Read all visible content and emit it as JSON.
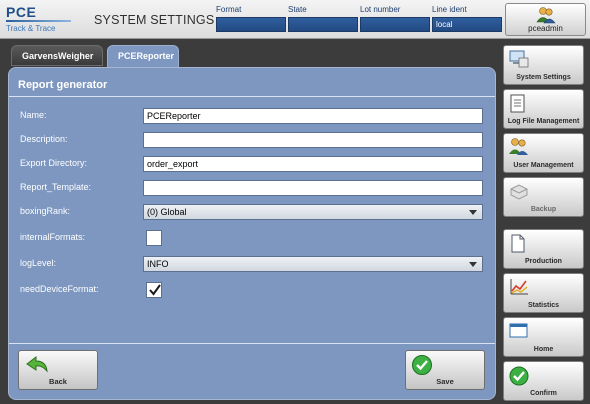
{
  "header": {
    "logo_main": "PCE",
    "logo_sub": "Track & Trace",
    "title": "SYSTEM SETTINGS",
    "fields": [
      {
        "label": "Format",
        "value": ""
      },
      {
        "label": "State",
        "value": ""
      },
      {
        "label": "Lot number",
        "value": ""
      },
      {
        "label": "Line ident",
        "value": "local"
      }
    ],
    "user_name": "pceadmin"
  },
  "tabs": [
    {
      "label": "GarvensWeigher",
      "active": false
    },
    {
      "label": "PCEReporter",
      "active": true
    }
  ],
  "form": {
    "section_title": "Report generator",
    "name": {
      "label": "Name:",
      "value": "PCEReporter"
    },
    "description": {
      "label": "Description:",
      "value": ""
    },
    "export_directory": {
      "label": "Export Directory:",
      "value": "order_export"
    },
    "report_template": {
      "label": "Report_Template:",
      "value": ""
    },
    "boxing_rank": {
      "label": "boxingRank:",
      "value": "(0) Global"
    },
    "internal_formats": {
      "label": "internalFormats:",
      "checked": false
    },
    "log_level": {
      "label": "logLevel:",
      "value": "INFO"
    },
    "need_device_format": {
      "label": "needDeviceFormat:",
      "checked": true
    }
  },
  "buttons": {
    "back": "Back",
    "save": "Save"
  },
  "sidebar": [
    {
      "label": "System Settings",
      "icon": "computer-icon"
    },
    {
      "label": "Log File Management",
      "icon": "log-file-icon"
    },
    {
      "label": "User Management",
      "icon": "users-icon"
    },
    {
      "label": "Backup",
      "icon": "backup-icon"
    },
    {
      "label": "Production",
      "icon": "document-icon"
    },
    {
      "label": "Statistics",
      "icon": "chart-icon"
    },
    {
      "label": "Home",
      "icon": "home-window-icon"
    },
    {
      "label": "Confirm",
      "icon": "check-icon"
    }
  ],
  "colors": {
    "panel": "#7d97c0",
    "header_field": "#2f5f9f",
    "accent_green": "#3cb043"
  }
}
